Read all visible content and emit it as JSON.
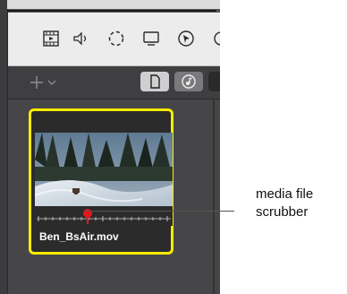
{
  "app": {
    "toolbar_icons": [
      "film-icon",
      "speaker-icon",
      "dashed-circle-icon",
      "display-icon",
      "cursor-circle-icon",
      "partial-icon"
    ],
    "add_menu_icon": "plus-chevron-icon",
    "segments": [
      {
        "name": "document-icon",
        "selected": true
      },
      {
        "name": "music-icon",
        "selected": false
      }
    ]
  },
  "media_tile": {
    "file_name": "Ben_BsAir.mov",
    "highlight_color": "#ffeb00",
    "playhead_color": "#e8141c",
    "scrubber_progress": 0.38
  },
  "annotation": {
    "line1": "media file",
    "line2": "scrubber"
  }
}
